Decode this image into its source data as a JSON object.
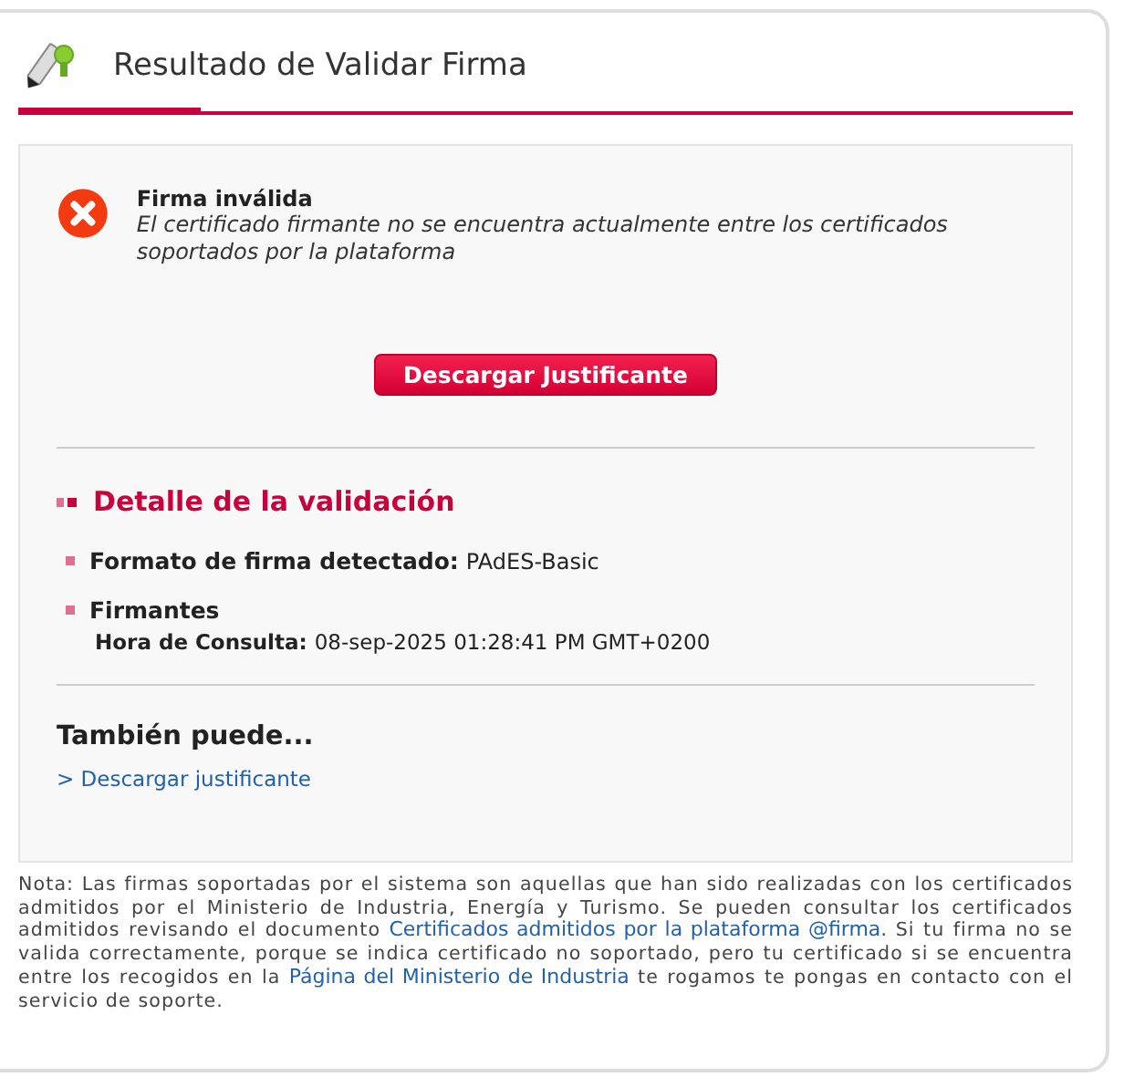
{
  "title": "Resultado de Validar Firma",
  "result": {
    "valid": false,
    "heading": "Firma inválida",
    "message": "El certificado firmante no se encuentra actualmente entre los certificados soportados por la plataforma"
  },
  "download_button": "Descargar Justificante",
  "details": {
    "title": "Detalle de la validación",
    "items": [
      {
        "label": "Formato de firma detectado:",
        "value": "PAdES-Basic"
      },
      {
        "label": "Firmantes",
        "sub_label": "Hora de Consulta:",
        "sub_value": "08-sep-2025 01:28:41 PM GMT+0200"
      }
    ]
  },
  "also": {
    "title": "También puede...",
    "links": [
      "> Descargar justificante"
    ]
  },
  "note": [
    {
      "kind": "text",
      "text": "Nota: Las firmas soportadas por el sistema son aquellas que han sido realizadas con los certificados admitidos por el Ministerio de Industria, Energía y Turismo. Se pueden consultar los certificados admitidos revisando el documento "
    },
    {
      "kind": "link",
      "text": "Certificados admitidos por la plataforma @firma."
    },
    {
      "kind": "text",
      "text": " Si tu firma no se valida correctamente, porque se indica certificado no soportado, pero tu certificado si se encuentra entre los recogidos en la "
    },
    {
      "kind": "link",
      "text": "Página del Ministerio de Industria"
    },
    {
      "kind": "text",
      "text": " te rogamos te pongas en contacto con el servicio de soporte."
    }
  ]
}
